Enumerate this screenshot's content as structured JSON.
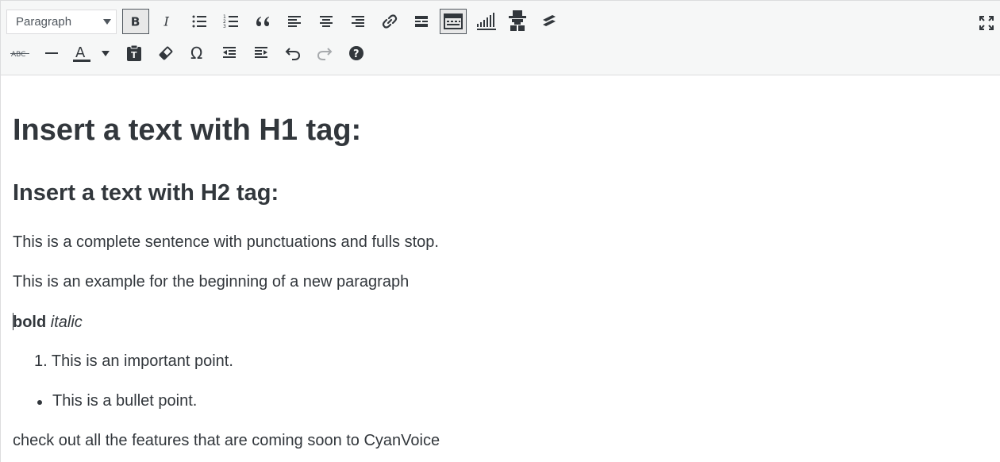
{
  "toolbar": {
    "format_select": "Paragraph",
    "row1_buttons": [
      "bold",
      "italic",
      "bulleted-list",
      "numbered-list",
      "blockquote",
      "align-left",
      "align-center",
      "align-right",
      "insert-link",
      "read-more",
      "toolbar-toggle",
      "signal-plugin",
      "avatar-plugin",
      "layers-plugin"
    ],
    "row2_buttons": [
      "strikethrough",
      "horizontal-line",
      "text-color",
      "paste-text",
      "clear-formatting",
      "special-character",
      "outdent",
      "indent",
      "undo",
      "redo",
      "help"
    ],
    "text_color_icon_letter": "A",
    "strike_label": "ABC",
    "fullscreen": "expand-icon"
  },
  "content": {
    "h1": "Insert a text with H1 tag:",
    "h2": "Insert a text with H2 tag:",
    "p1": "This is a complete sentence with punctuations and fulls stop.",
    "p2": "This is an example for the beginning of a new paragraph",
    "bold_word": "bold",
    "italic_word": "italic",
    "ol_number": "1.",
    "ol_item": "This is an important point.",
    "ul_item": "This is a bullet point.",
    "p4": "check out all the features that are coming soon to CyanVoice"
  },
  "colors": {
    "toolbar_bg": "#f6f7f7",
    "text": "#32373c",
    "text_color_bar": "#32373c",
    "border": "#dcdcde"
  }
}
